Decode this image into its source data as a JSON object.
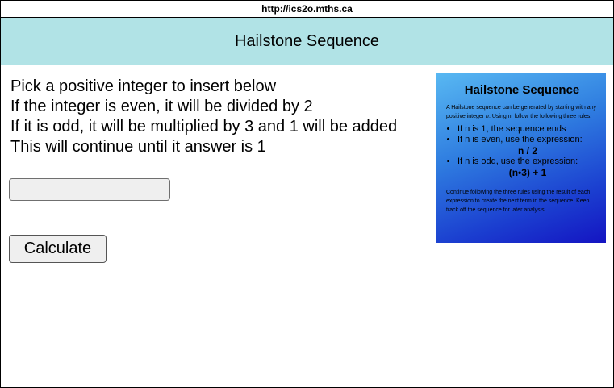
{
  "browser": {
    "url": "http://ics2o.mths.ca"
  },
  "header": {
    "title": "Hailstone Sequence"
  },
  "instructions": {
    "lines": [
      "Pick a positive integer to insert below",
      "If the integer is even, it will be divided by 2",
      "If it is odd, it will be multiplied by 3 and 1 will be added",
      "This will continue until it answer is 1"
    ]
  },
  "form": {
    "input_value": "",
    "input_placeholder": "",
    "calculate_label": "Calculate"
  },
  "info_card": {
    "title": "Hailstone Sequence",
    "intro_before": "A Hailstone sequence can be generated by starting with any positive integer ",
    "intro_var": "n",
    "intro_after": ". Using n, follow the following three rules:",
    "rules": [
      {
        "text": "If n is 1, the sequence ends",
        "expression": ""
      },
      {
        "text": "If n is even, use the expression:",
        "expression": "n / 2"
      },
      {
        "text": "If n is odd, use the expression:",
        "expression": "(n•3) + 1"
      }
    ],
    "outro": "Continue following the three rules using the result of each expression to create the next term in the sequence. Keep track off the sequence for later analysis."
  },
  "colors": {
    "header_bg": "#b1e3e6",
    "card_gradient_start": "#58b8f2",
    "card_gradient_end": "#1414c2"
  }
}
